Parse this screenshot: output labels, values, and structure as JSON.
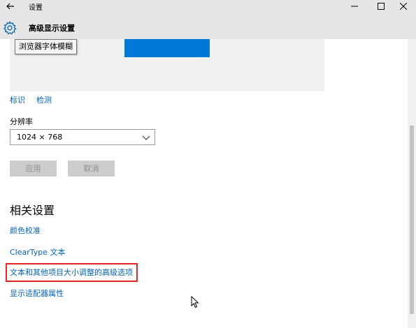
{
  "window": {
    "title": "设置",
    "controls": {
      "minimize": "minimize-icon",
      "maximize": "maximize-icon",
      "close": "close-icon"
    }
  },
  "header": {
    "icon": "gear-icon",
    "title": "高级显示设置"
  },
  "tooltip": {
    "text": "浏览器字体模糊"
  },
  "display": {
    "identify_label": "标识",
    "detect_label": "检测",
    "resolution_label": "分辨率",
    "resolution_value": "1024 × 768",
    "apply_label": "应用",
    "cancel_label": "取消"
  },
  "related": {
    "title": "相关设置",
    "links": [
      "颜色校准",
      "ClearType 文本",
      "文本和其他项目大小调整的高级选项",
      "显示适配器属性"
    ]
  },
  "colors": {
    "accent": "#0078d7",
    "link": "#0063b1",
    "highlight_border": "#e0261f"
  }
}
